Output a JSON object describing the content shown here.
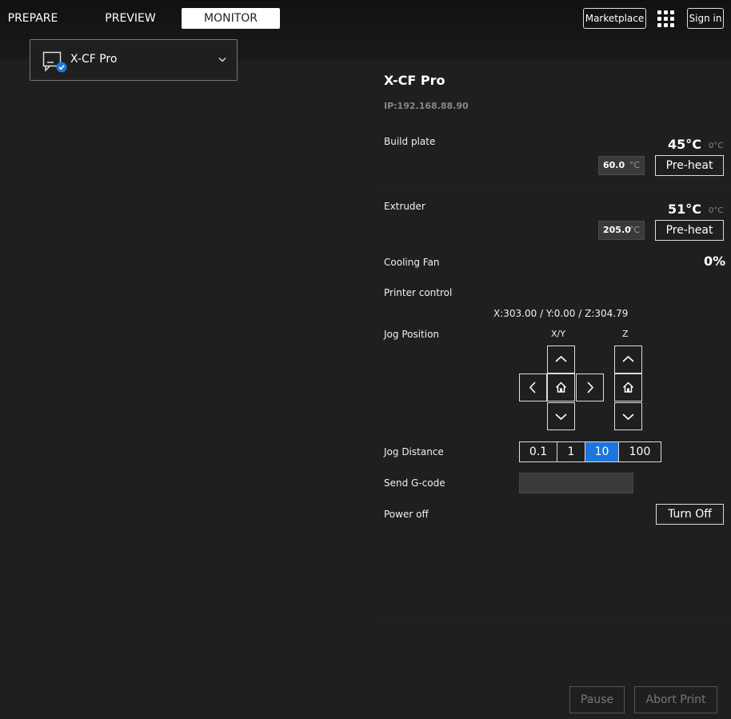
{
  "header": {
    "tabs": [
      {
        "label": "PREPARE"
      },
      {
        "label": "PREVIEW"
      },
      {
        "label": "MONITOR"
      }
    ],
    "marketplace_label": "Marketplace",
    "signin_label": "Sign in"
  },
  "printer_selector": {
    "name": "X-CF Pro"
  },
  "monitor": {
    "printer_name": "X-CF Pro",
    "ip": "IP:192.168.88.90",
    "build_plate": {
      "label": "Build plate",
      "current": "45°C",
      "target_reading": "0°C",
      "target_value": "60.0",
      "unit": "°C",
      "preheat_label": "Pre-heat"
    },
    "extruder": {
      "label": "Extruder",
      "current": "51°C",
      "target_reading": "0°C",
      "target_value": "205.0",
      "unit": "°C",
      "preheat_label": "Pre-heat"
    },
    "cooling_fan": {
      "label": "Cooling Fan",
      "value": "0%"
    },
    "printer_control_label": "Printer control",
    "position_readout": "X:303.00 / Y:0.00 / Z:304.79",
    "jog_position": {
      "label": "Jog Position",
      "xy_label": "X/Y",
      "z_label": "Z"
    },
    "jog_distance": {
      "label": "Jog Distance",
      "options": [
        "0.1",
        "1",
        "10",
        "100"
      ],
      "selected": "10"
    },
    "send_gcode": {
      "label": "Send G-code",
      "value": ""
    },
    "power_off": {
      "label": "Power off",
      "button_label": "Turn Off"
    }
  },
  "footer": {
    "pause_label": "Pause",
    "abort_label": "Abort Print"
  },
  "colors": {
    "accent": "#1c76dd",
    "background": "#1f1f1f",
    "topbar": "#111111"
  }
}
